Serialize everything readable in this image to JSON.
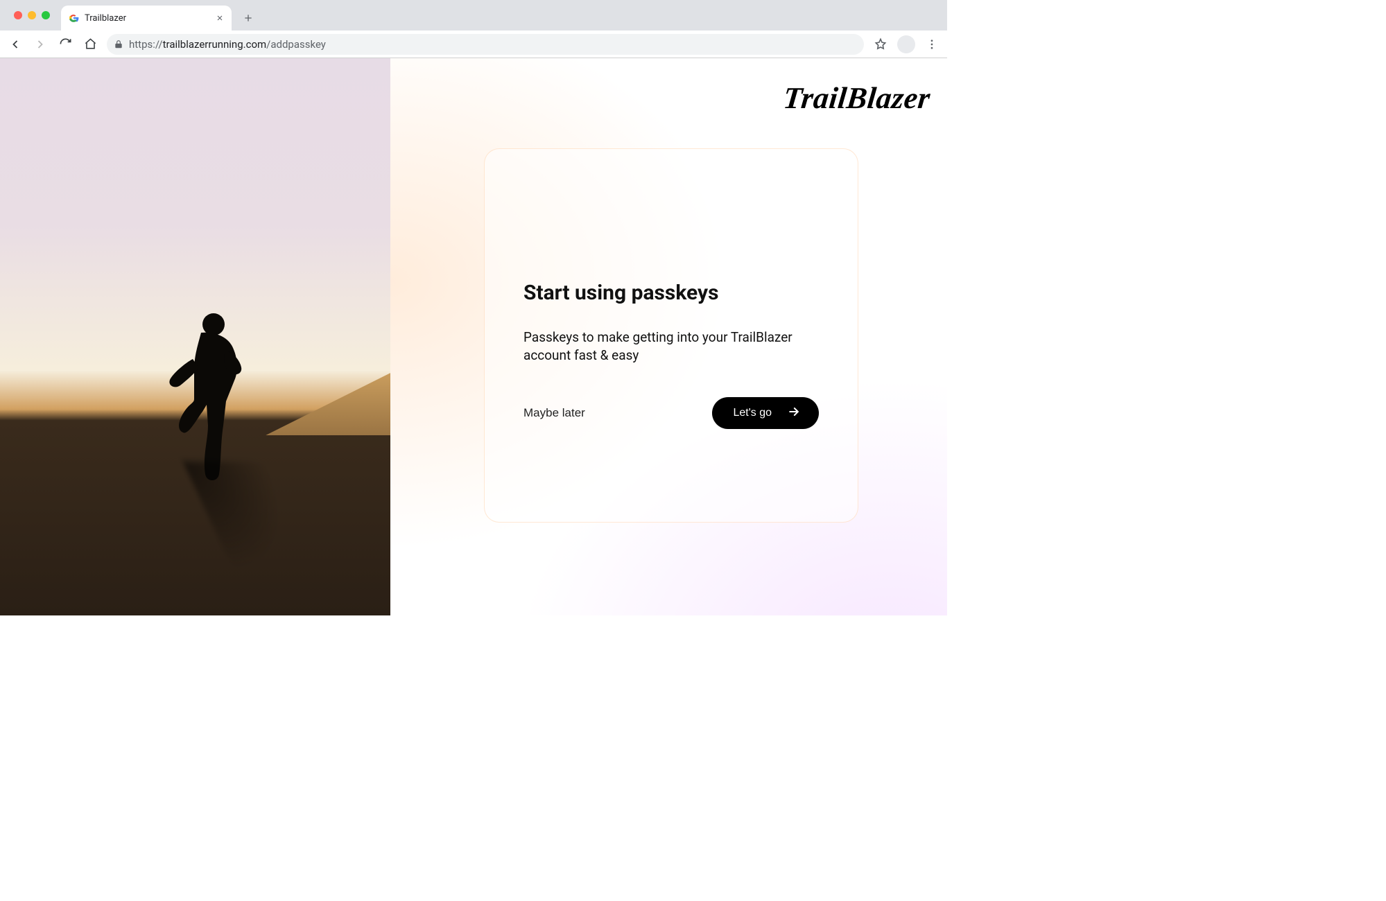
{
  "browser": {
    "tab_title": "Trailblazer",
    "url_scheme": "https://",
    "url_domain": "trailblazerrunning.com",
    "url_path": "/addpasskey"
  },
  "brand": "TrailBlazer",
  "card": {
    "title": "Start using passkeys",
    "subtitle": "Passkeys to make getting into your TrailBlazer account fast & easy",
    "secondary_action": "Maybe later",
    "primary_action": "Let's go"
  }
}
